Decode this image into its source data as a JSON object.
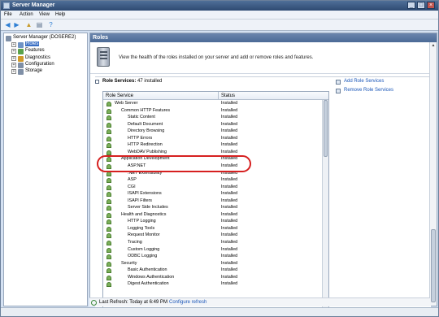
{
  "window": {
    "title": "Server Manager",
    "min": "_",
    "max": "□",
    "close": "×"
  },
  "menu": [
    "File",
    "Action",
    "View",
    "Help"
  ],
  "toolbar": [
    {
      "icon": "back-arrow-icon",
      "glyph": "◀",
      "color": "#2f7fd4"
    },
    {
      "icon": "forward-arrow-icon",
      "glyph": "▶",
      "color": "#2f7fd4"
    },
    {
      "icon": "folder-up-icon",
      "glyph": "▲",
      "color": "#c79a2a"
    },
    {
      "icon": "show-hide-tree-icon",
      "glyph": "▤",
      "color": "#5a6f8a"
    },
    {
      "icon": "help-icon",
      "glyph": "?",
      "color": "#2f7fd4"
    }
  ],
  "tree": [
    {
      "label": "Server Manager (DOSERE2)",
      "level": 0,
      "expander": "",
      "color": "#7f8fa6",
      "selected": false
    },
    {
      "label": "Roles",
      "level": 1,
      "expander": "+",
      "color": "#6f93c4",
      "selected": true
    },
    {
      "label": "Features",
      "level": 1,
      "expander": "+",
      "color": "#5aa24a",
      "selected": false
    },
    {
      "label": "Diagnostics",
      "level": 1,
      "expander": "+",
      "color": "#d19a2a",
      "selected": false
    },
    {
      "label": "Configuration",
      "level": 1,
      "expander": "+",
      "color": "#7f8fa6",
      "selected": false
    },
    {
      "label": "Storage",
      "level": 1,
      "expander": "+",
      "color": "#7f8fa6",
      "selected": false
    }
  ],
  "main": {
    "header": "Roles",
    "intro": "View the health of the roles installed on your server and add or remove roles and features."
  },
  "role_services": {
    "title": "Role Services:",
    "count": "47 installed",
    "columns": [
      "Role Service",
      "Status"
    ],
    "rows": [
      {
        "name": "Web Server",
        "status": "Installed",
        "indent": 0
      },
      {
        "name": "Common HTTP Features",
        "status": "Installed",
        "indent": 1
      },
      {
        "name": "Static Content",
        "status": "Installed",
        "indent": 2
      },
      {
        "name": "Default Document",
        "status": "Installed",
        "indent": 2
      },
      {
        "name": "Directory Browsing",
        "status": "Installed",
        "indent": 2
      },
      {
        "name": "HTTP Errors",
        "status": "Installed",
        "indent": 2
      },
      {
        "name": "HTTP Redirection",
        "status": "Installed",
        "indent": 2
      },
      {
        "name": "WebDAV Publishing",
        "status": "Installed",
        "indent": 2
      },
      {
        "name": "Application Development",
        "status": "Installed",
        "indent": 1
      },
      {
        "name": "ASP.NET",
        "status": "Installed",
        "indent": 2
      },
      {
        "name": ".NET Extensibility",
        "status": "Installed",
        "indent": 2
      },
      {
        "name": "ASP",
        "status": "Installed",
        "indent": 2
      },
      {
        "name": "CGI",
        "status": "Installed",
        "indent": 2
      },
      {
        "name": "ISAPI Extensions",
        "status": "Installed",
        "indent": 2
      },
      {
        "name": "ISAPI Filters",
        "status": "Installed",
        "indent": 2
      },
      {
        "name": "Server Side Includes",
        "status": "Installed",
        "indent": 2
      },
      {
        "name": "Health and Diagnostics",
        "status": "Installed",
        "indent": 1
      },
      {
        "name": "HTTP Logging",
        "status": "Installed",
        "indent": 2
      },
      {
        "name": "Logging Tools",
        "status": "Installed",
        "indent": 2
      },
      {
        "name": "Request Monitor",
        "status": "Installed",
        "indent": 2
      },
      {
        "name": "Tracing",
        "status": "Installed",
        "indent": 2
      },
      {
        "name": "Custom Logging",
        "status": "Installed",
        "indent": 2
      },
      {
        "name": "ODBC Logging",
        "status": "Installed",
        "indent": 2
      },
      {
        "name": "Security",
        "status": "Installed",
        "indent": 1
      },
      {
        "name": "Basic Authentication",
        "status": "Installed",
        "indent": 2
      },
      {
        "name": "Windows Authentication",
        "status": "Installed",
        "indent": 2
      },
      {
        "name": "Digest Authentication",
        "status": "Installed",
        "indent": 2
      }
    ]
  },
  "actions": [
    "Add Role Services",
    "Remove Role Services"
  ],
  "status": {
    "last_refresh": "Last Refresh: Today at 6:49 PM",
    "configure_link": "Configure refresh"
  }
}
